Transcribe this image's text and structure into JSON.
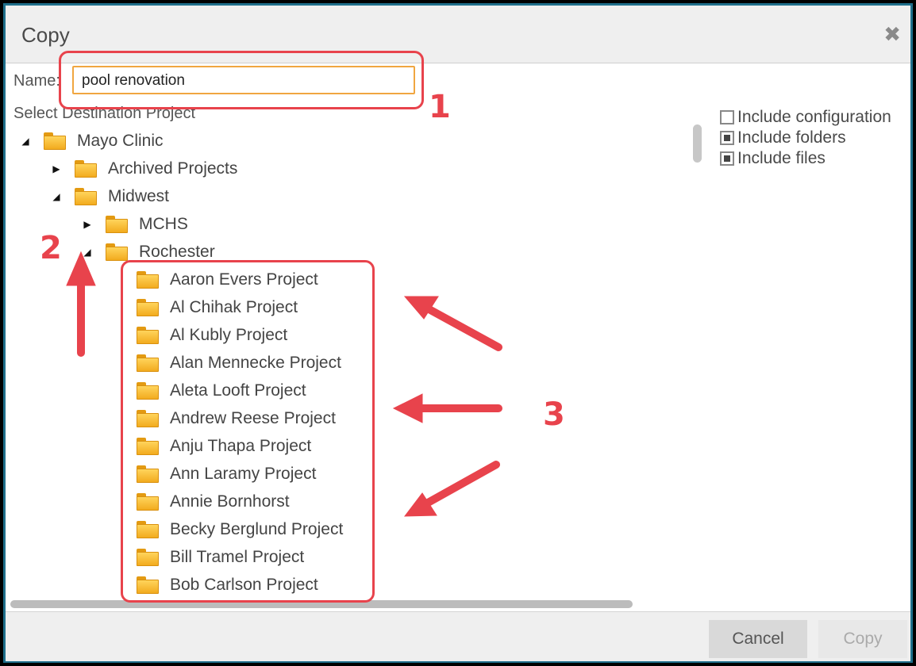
{
  "dialog": {
    "title": "Copy",
    "close_icon": "close-icon"
  },
  "name_field": {
    "label": "Name:",
    "value": "pool renovation"
  },
  "destination_label": "Select Destination Project",
  "options": [
    {
      "label": "Include configuration",
      "checked": false
    },
    {
      "label": "Include folders",
      "checked": true
    },
    {
      "label": "Include files",
      "checked": true
    }
  ],
  "tree": [
    {
      "label": "Mayo Clinic",
      "level": 0,
      "toggle": "expanded"
    },
    {
      "label": "Archived Projects",
      "level": 1,
      "toggle": "collapsed"
    },
    {
      "label": "Midwest",
      "level": 1,
      "toggle": "expanded"
    },
    {
      "label": "MCHS",
      "level": 2,
      "toggle": "collapsed"
    },
    {
      "label": "Rochester",
      "level": 2,
      "toggle": "expanded"
    },
    {
      "label": "Aaron Evers Project",
      "level": 3,
      "toggle": "none"
    },
    {
      "label": "Al Chihak Project",
      "level": 3,
      "toggle": "none"
    },
    {
      "label": "Al Kubly Project",
      "level": 3,
      "toggle": "none"
    },
    {
      "label": "Alan Mennecke Project",
      "level": 3,
      "toggle": "none"
    },
    {
      "label": "Aleta Looft Project",
      "level": 3,
      "toggle": "none"
    },
    {
      "label": "Andrew Reese Project",
      "level": 3,
      "toggle": "none"
    },
    {
      "label": "Anju Thapa Project",
      "level": 3,
      "toggle": "none"
    },
    {
      "label": "Ann Laramy Project",
      "level": 3,
      "toggle": "none"
    },
    {
      "label": "Annie Bornhorst",
      "level": 3,
      "toggle": "none"
    },
    {
      "label": "Becky Berglund Project",
      "level": 3,
      "toggle": "none"
    },
    {
      "label": "Bill Tramel Project",
      "level": 3,
      "toggle": "none"
    },
    {
      "label": "Bob Carlson Project",
      "level": 3,
      "toggle": "none"
    }
  ],
  "footer": {
    "cancel_label": "Cancel",
    "copy_label": "Copy"
  },
  "annotations": {
    "step1": "1",
    "step2": "2",
    "step3": "3",
    "color": "#e8434c"
  },
  "colors": {
    "input_border": "#f0a640",
    "folder": "#f2ab1e",
    "dialog_border": "#1f6f8b"
  }
}
